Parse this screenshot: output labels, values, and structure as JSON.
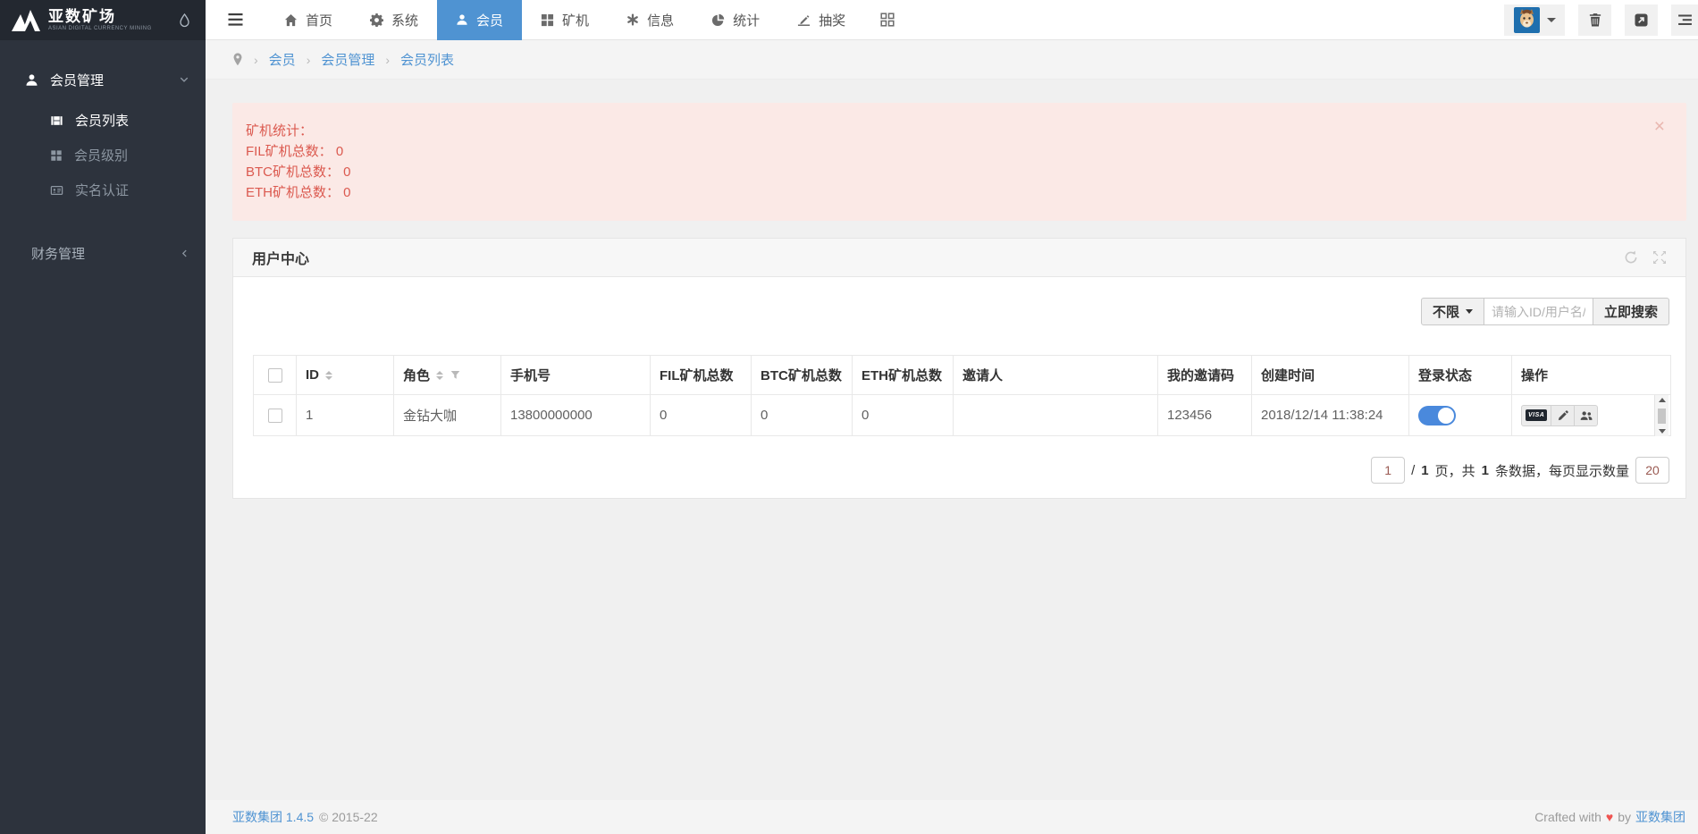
{
  "app": {
    "logo_title": "亚数矿场",
    "logo_subtitle": "ASIAN DIGITAL CURRENCY MINING"
  },
  "sidebar": {
    "group1": {
      "label": "会员管理"
    },
    "group1_items": [
      {
        "label": "会员列表"
      },
      {
        "label": "会员级别"
      },
      {
        "label": "实名认证"
      }
    ],
    "group2": {
      "label": "财务管理"
    }
  },
  "navbar": {
    "items": [
      {
        "label": "首页"
      },
      {
        "label": "系统"
      },
      {
        "label": "会员"
      },
      {
        "label": "矿机"
      },
      {
        "label": "信息"
      },
      {
        "label": "统计"
      },
      {
        "label": "抽奖"
      }
    ]
  },
  "breadcrumb": {
    "separator": "›",
    "items": [
      {
        "label": "会员"
      },
      {
        "label": "会员管理"
      },
      {
        "label": "会员列表"
      }
    ]
  },
  "alert": {
    "title": "矿机统计：",
    "lines": [
      "FIL矿机总数： 0",
      "BTC矿机总数： 0",
      "ETH矿机总数： 0"
    ],
    "close": "×"
  },
  "panel": {
    "title": "用户中心"
  },
  "toolbar": {
    "filter": "不限",
    "placeholder": "请输入ID/用户名/",
    "search": "立即搜索"
  },
  "table": {
    "headers": {
      "id": "ID",
      "role": "角色",
      "phone": "手机号",
      "fil": "FIL矿机总数",
      "btc": "BTC矿机总数",
      "eth": "ETH矿机总数",
      "inviter": "邀请人",
      "code": "我的邀请码",
      "created": "创建时间",
      "status": "登录状态",
      "actions": "操作"
    },
    "row": {
      "id": "1",
      "role": "金钻大咖",
      "phone": "13800000000",
      "fil": "0",
      "btc": "0",
      "eth": "0",
      "inviter": "",
      "code": "123456",
      "created": "2018/12/14 11:38:24"
    },
    "visa_label": "VISA"
  },
  "pagination": {
    "page": "1",
    "slash": "/",
    "total_pages": "1",
    "pages_label": "页，共",
    "total_count": "1",
    "count_label": "条数据，每页显示数量",
    "size": "20"
  },
  "footer": {
    "brand": "亚数集团 1.4.5",
    "copyright": "© 2015-22",
    "crafted_pre": "Crafted with",
    "heart": "♥",
    "crafted_by": "by",
    "crafted_brand": "亚数集团"
  },
  "colors": {
    "accent": "#4f93d2",
    "toggle_on": "#4a89dc",
    "alert_bg": "#fbe9e6",
    "alert_text": "#db594f",
    "sidebar_bg": "#2d333d"
  }
}
